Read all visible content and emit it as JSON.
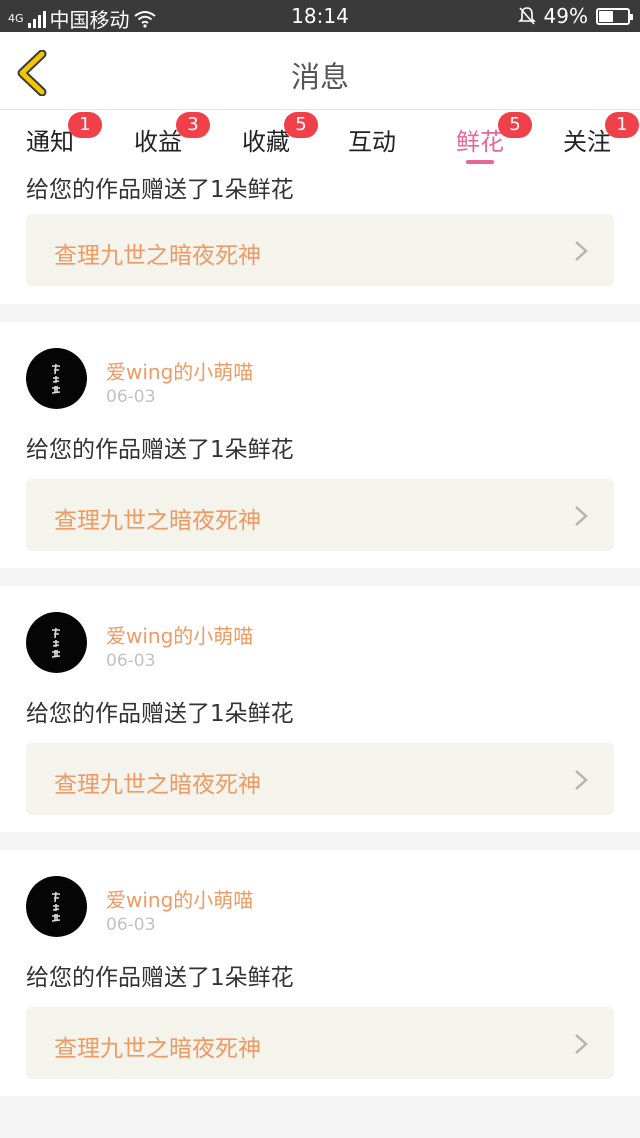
{
  "status_bar": {
    "network": "4G",
    "carrier": "中国移动",
    "time": "18:14",
    "battery": "49%",
    "battery_level": 0.49
  },
  "header": {
    "title": "消息"
  },
  "tabs": [
    {
      "label": "通知",
      "badge": "1"
    },
    {
      "label": "收益",
      "badge": "3"
    },
    {
      "label": "收藏",
      "badge": "5"
    },
    {
      "label": "互动",
      "badge": ""
    },
    {
      "label": "鲜花",
      "badge": "5",
      "active": true
    },
    {
      "label": "关注",
      "badge": "1"
    }
  ],
  "messages": [
    {
      "text": "给您的作品赠送了1朵鲜花",
      "work_title": "查理九世之暗夜死神"
    },
    {
      "user": "爱wing的小萌喵",
      "date": "06-03",
      "text": "给您的作品赠送了1朵鲜花",
      "work_title": "查理九世之暗夜死神"
    },
    {
      "user": "爱wing的小萌喵",
      "date": "06-03",
      "text": "给您的作品赠送了1朵鲜花",
      "work_title": "查理九世之暗夜死神"
    },
    {
      "user": "爱wing的小萌喵",
      "date": "06-03",
      "text": "给您的作品赠送了1朵鲜花",
      "work_title": "查理九世之暗夜死神"
    }
  ],
  "colors": {
    "accent_pink": "#e5679a",
    "badge_red": "#f0404a",
    "link_orange": "#ef9a63",
    "back_yellow": "#f2c700"
  }
}
